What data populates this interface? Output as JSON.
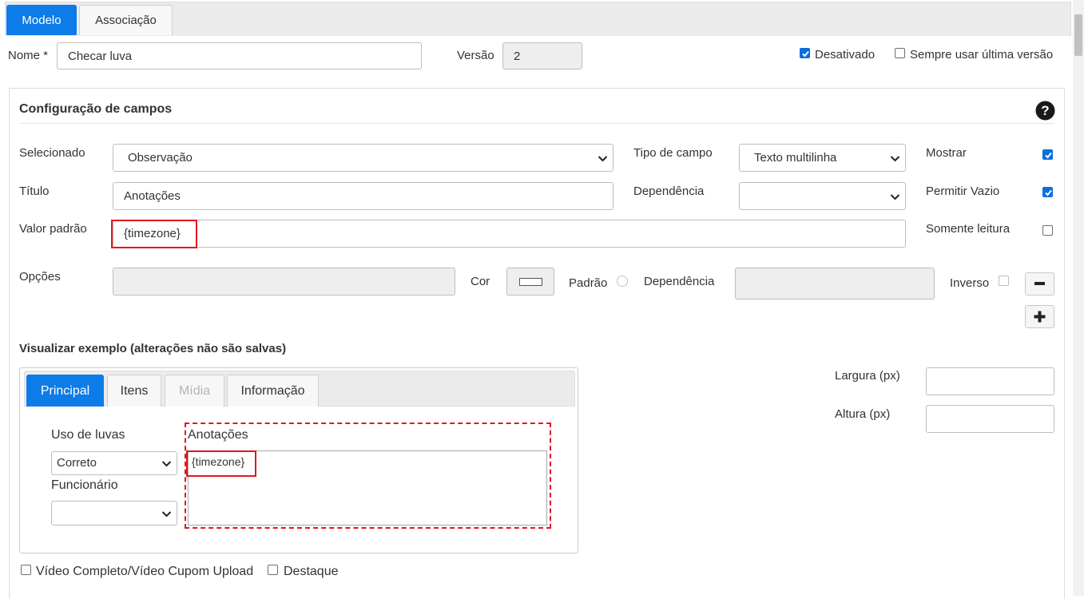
{
  "tabs": [
    "Modelo",
    "Associação"
  ],
  "header": {
    "name_label": "Nome *",
    "name_value": "Checar luva",
    "version_label": "Versão",
    "version_value": "2",
    "desativado_label": "Desativado",
    "desativado_checked": true,
    "sempre_label": "Sempre usar última versão",
    "sempre_checked": false
  },
  "config": {
    "title": "Configuração de campos",
    "help_icon": "question-circle-icon",
    "selecionado_label": "Selecionado",
    "selecionado_value": "Observação",
    "tipo_label": "Tipo de campo",
    "tipo_value": "Texto multilinha",
    "mostrar_label": "Mostrar",
    "mostrar_checked": true,
    "titulo_label": "Título",
    "titulo_value": "Anotações",
    "dependencia_label": "Dependência",
    "dependencia_value": "",
    "permitir_label": "Permitir Vazio",
    "permitir_checked": true,
    "valor_label": "Valor padrão",
    "valor_value": "{timezone}",
    "somente_label": "Somente leitura",
    "somente_checked": false,
    "opcoes_label": "Opções",
    "cor_label": "Cor",
    "padrao_label": "Padrão",
    "dependencia2_label": "Dependência",
    "inverso_label": "Inverso"
  },
  "preview": {
    "title": "Visualizar exemplo (alterações não são salvas)",
    "tabs": [
      "Principal",
      "Itens",
      "Mídia",
      "Informação"
    ],
    "uso_label": "Uso de luvas",
    "uso_value": "Correto",
    "funcionario_label": "Funcionário",
    "funcionario_value": "",
    "anotacoes_label": "Anotações",
    "anotacoes_value": "{timezone}",
    "largura_label": "Largura (px)",
    "altura_label": "Altura (px)"
  },
  "footer": {
    "video_label": "Vídeo Completo/Vídeo Cupom Upload",
    "video_checked": false,
    "destaque_label": "Destaque",
    "destaque_checked": false
  },
  "colors": {
    "accent": "#0d7ce9",
    "highlight": "#e3171d",
    "checkbox": "#0b6fde"
  }
}
